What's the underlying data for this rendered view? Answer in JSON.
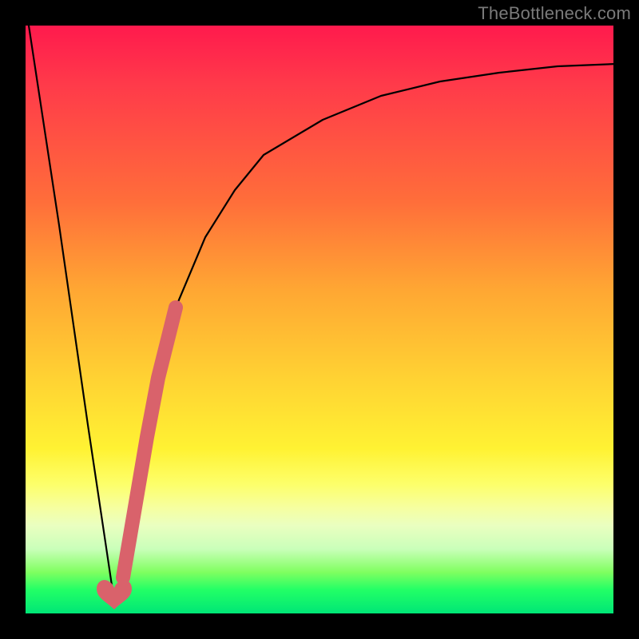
{
  "watermark": "TheBottleneck.com",
  "colors": {
    "curve": "#000000",
    "accent": "#d9626b",
    "gradient_top": "#ff1a4d",
    "gradient_bottom": "#00e676"
  },
  "chart_data": {
    "type": "line",
    "title": "",
    "xlabel": "",
    "ylabel": "",
    "xlim": [
      0,
      100
    ],
    "ylim": [
      0,
      100
    ],
    "grid": false,
    "legend": false,
    "series": [
      {
        "name": "bottleneck-curve",
        "x": [
          0,
          5,
          10,
          13,
          14.5,
          16,
          18,
          20,
          22,
          25,
          30,
          35,
          40,
          50,
          60,
          70,
          80,
          90,
          100
        ],
        "y": [
          100,
          66,
          32,
          12,
          2,
          6,
          18,
          30,
          40,
          52,
          64,
          72,
          78,
          84,
          88,
          90.5,
          92,
          93,
          93.5
        ]
      }
    ],
    "highlight_segment": {
      "series": "bottleneck-curve",
      "x_range": [
        16,
        25
      ],
      "note": "thick segment"
    },
    "marker": {
      "shape": "heart",
      "x": 14.5,
      "y": 2
    }
  }
}
